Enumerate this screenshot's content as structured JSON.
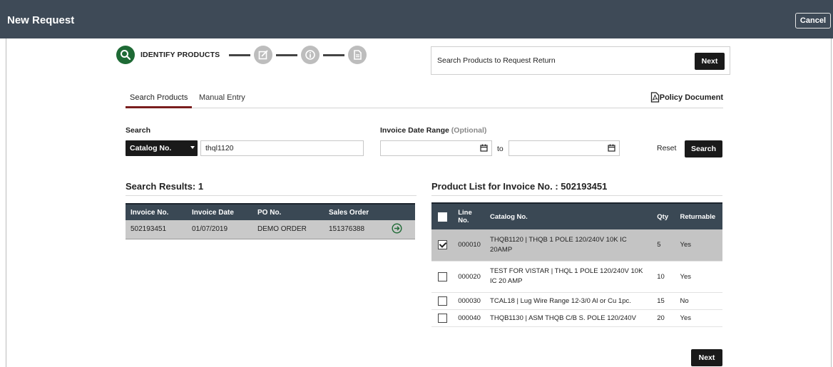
{
  "header": {
    "title": "New Request",
    "cancel_label": "Cancel"
  },
  "stepper": {
    "active_label": "IDENTIFY PRODUCTS"
  },
  "action_box": {
    "message": "Search Products to Request Return",
    "next_label": "Next"
  },
  "tabs": [
    {
      "label": "Search Products",
      "active": true
    },
    {
      "label": "Manual Entry",
      "active": false
    }
  ],
  "policy_label": "Policy Document",
  "search": {
    "label": "Search",
    "type_selected": "Catalog No.",
    "value": "thql1120",
    "date_label": "Invoice Date Range",
    "date_optional": "(Optional)",
    "date_from": "",
    "date_to": "",
    "to_label": "to",
    "reset_label": "Reset",
    "search_label": "Search"
  },
  "results": {
    "title": "Search Results: 1",
    "columns": [
      "Invoice No.",
      "Invoice Date",
      "PO No.",
      "Sales Order"
    ],
    "rows": [
      {
        "invoice": "502193451",
        "date": "01/07/2019",
        "po": "DEMO ORDER",
        "sales_order": "151376388"
      }
    ]
  },
  "products": {
    "title": "Product List for Invoice No. : 502193451",
    "columns": {
      "line": "Line No.",
      "catalog": "Catalog No.",
      "qty": "Qty",
      "returnable": "Returnable"
    },
    "rows": [
      {
        "line": "000010",
        "catalog": "THQB1120 | THQB 1 POLE 120/240V 10K IC 20AMP",
        "qty": "5",
        "returnable": "Yes",
        "checked": true
      },
      {
        "line": "000020",
        "catalog": "TEST FOR VISTAR | THQL 1 POLE 120/240V 10K IC 20 AMP",
        "qty": "10",
        "returnable": "Yes",
        "checked": false
      },
      {
        "line": "000030",
        "catalog": "TCAL18 | Lug Wire Range 12-3/0 Al or Cu 1pc.",
        "qty": "15",
        "returnable": "No",
        "checked": false
      },
      {
        "line": "000040",
        "catalog": "THQB1130 | ASM THQB C/B S. POLE 120/240V",
        "qty": "20",
        "returnable": "Yes",
        "checked": false
      }
    ]
  },
  "footer": {
    "next_label": "Next"
  },
  "colors": {
    "header_bg": "#3e4a57",
    "active_step": "#1e6a35",
    "tab_accent": "#7a1e1e",
    "button": "#1a1a1a"
  }
}
